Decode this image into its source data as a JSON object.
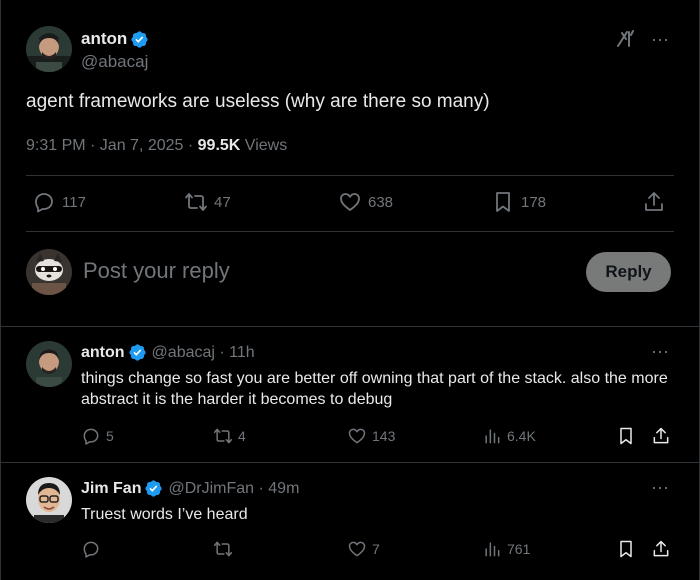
{
  "tweet": {
    "author_name": "anton",
    "author_handle": "@abacaj",
    "text": "agent frameworks are useless (why are there so many)",
    "time": "9:31 PM · Jan 7, 2025 · ",
    "views_count": "99.5K",
    "views_label": " Views",
    "replies": "117",
    "reposts": "47",
    "likes": "638",
    "bookmarks": "178"
  },
  "composer": {
    "placeholder": "Post your reply",
    "button_label": "Reply"
  },
  "top_bar": {
    "grok_label": "X/",
    "more_label": "···"
  },
  "replies": [
    {
      "name": "anton",
      "handle": "@abacaj · 11h",
      "text": "things change so fast you are better off owning that part of the stack. also the more abstract it is the harder it becomes to debug",
      "replies": "5",
      "reposts": "4",
      "likes": "143",
      "views": "6.4K",
      "more_label": "···"
    },
    {
      "name": "Jim Fan",
      "handle": "@DrJimFan · 49m",
      "text": "Truest words I’ve heard",
      "replies": "",
      "reposts": "",
      "likes": "7",
      "views": "761",
      "more_label": "···"
    }
  ],
  "colors": {
    "background": "#000000",
    "text": "#e7e9ea",
    "muted": "#71767b",
    "verified": "#1d9bf0",
    "border": "#2f3336"
  }
}
